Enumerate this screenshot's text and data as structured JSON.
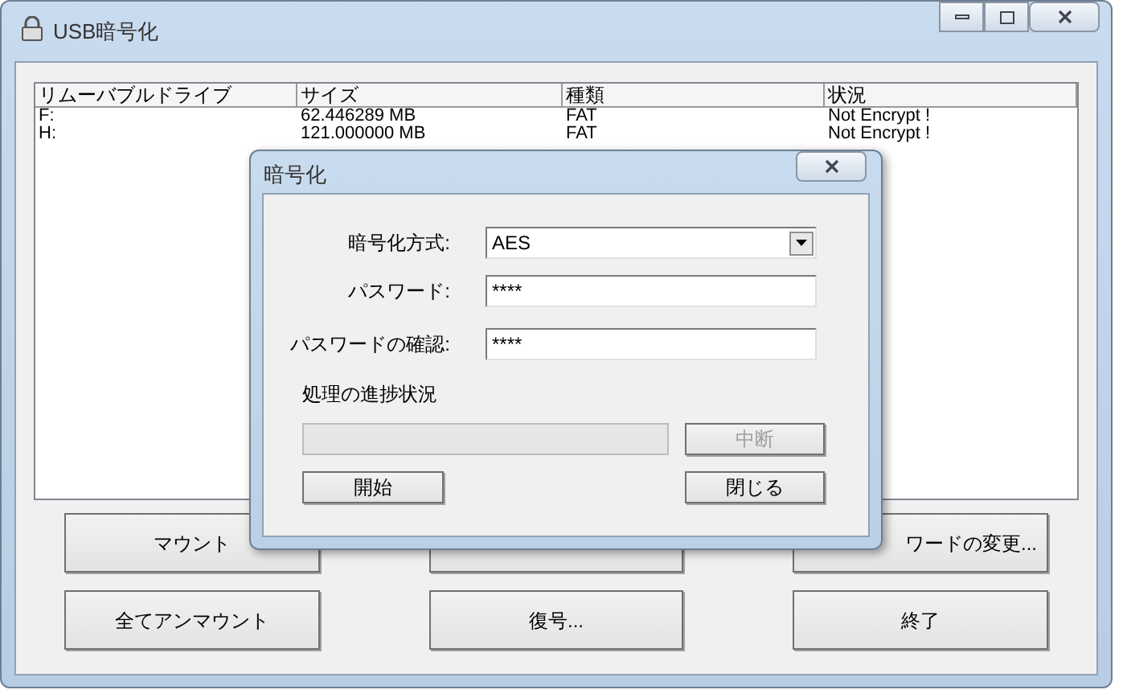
{
  "window": {
    "title": "USB暗号化"
  },
  "table": {
    "columns": [
      "リムーバブルドライブ",
      "サイズ",
      "種類",
      "状況"
    ],
    "rows": [
      [
        "F:",
        "62.446289 MB",
        "FAT",
        "Not Encrypt !"
      ],
      [
        "H:",
        "121.000000 MB",
        "FAT",
        "Not Encrypt !"
      ]
    ]
  },
  "buttons": [
    {
      "kind": "button",
      "label": "マウント"
    },
    {
      "kind": "covered"
    },
    {
      "kind": "button",
      "label": "ワードの変更..."
    },
    {
      "kind": "button",
      "label": "全てアンマウント"
    },
    {
      "kind": "button",
      "label": "復号..."
    },
    {
      "kind": "button",
      "label": "終了"
    }
  ],
  "dialog": {
    "title": "暗号化",
    "method": {
      "label": "暗号化方式:",
      "value": "AES"
    },
    "password": {
      "label": "パスワード:",
      "value": "****"
    },
    "confirm": {
      "label": "パスワードの確認:",
      "value": "****"
    },
    "progress_label": "処理の進捗状況",
    "progress": {
      "level": 0
    },
    "buttons": [
      {
        "label": "中断",
        "disabled": true
      },
      {
        "label": "開始",
        "disabled": false
      },
      {
        "label": "閉じる",
        "disabled": false
      }
    ]
  }
}
